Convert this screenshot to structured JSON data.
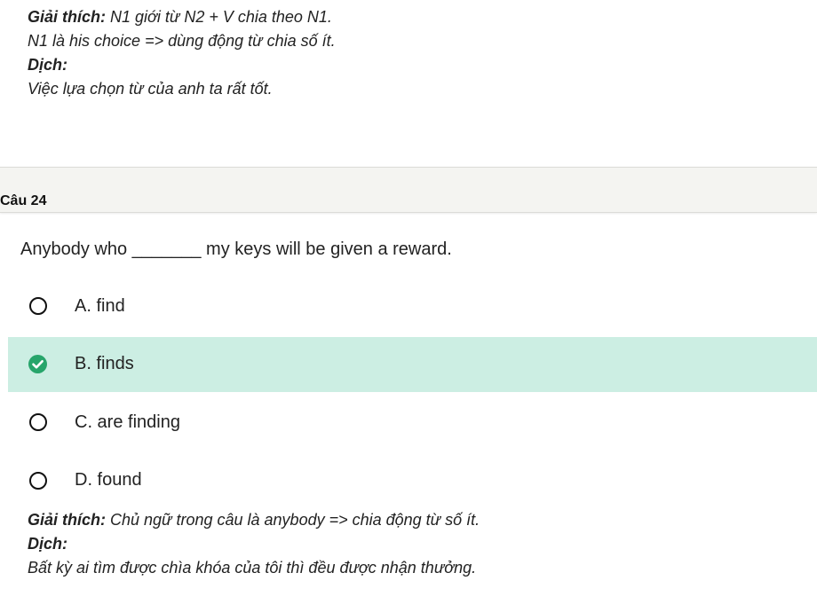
{
  "previous_explanation": {
    "explain_label": "Giải thích:",
    "explain_text": " N1 giới từ N2 + V chia theo N1.",
    "line2": "N1 là his choice => dùng động từ chia số ít.",
    "translate_label": "Dịch:",
    "translation": "Việc lựa chọn từ của anh ta rất tốt."
  },
  "question": {
    "number_label": "Câu 24",
    "text": "Anybody who _______ my keys will be given a reward.",
    "options": [
      {
        "label": "A. find",
        "state": "unselected"
      },
      {
        "label": "B. finds",
        "state": "correct"
      },
      {
        "label": "C. are finding",
        "state": "unselected"
      },
      {
        "label": "D. found",
        "state": "unselected"
      }
    ],
    "correct_highlight_color": "#cceee3",
    "check_color": "#27a56b",
    "explanation": {
      "explain_label": "Giải thích:",
      "explain_text": " Chủ ngữ trong câu là anybody => chia động từ số ít.",
      "translate_label": "Dịch:",
      "translation": "Bất kỳ ai tìm được chìa khóa của tôi thì đều được nhận thưởng."
    }
  }
}
